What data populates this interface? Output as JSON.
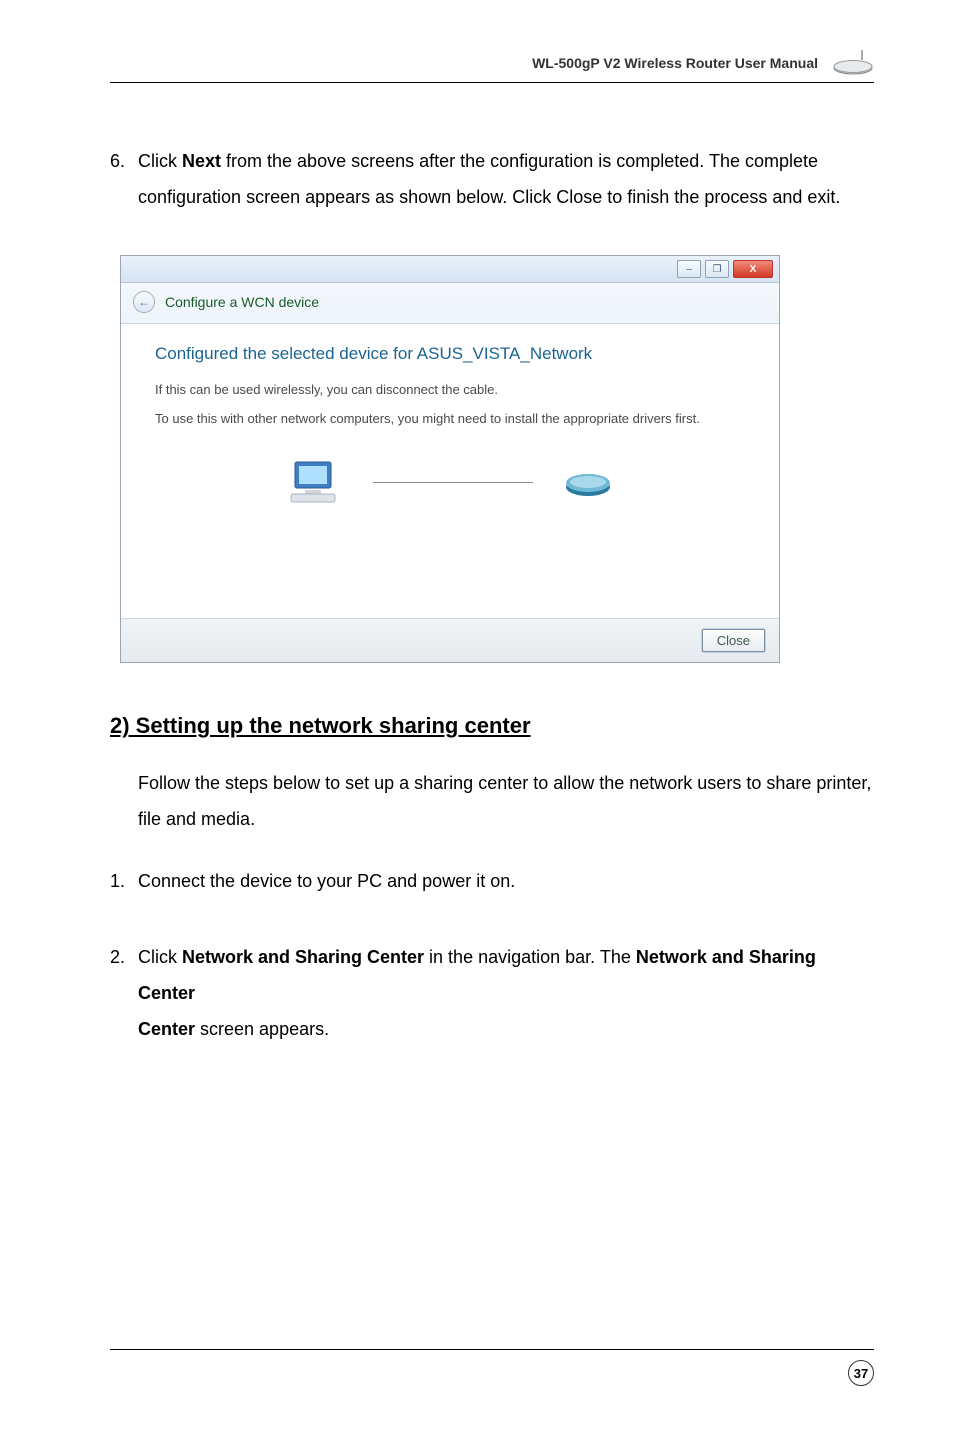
{
  "header": {
    "title": "WL-500gP V2 Wireless Router User Manual"
  },
  "step6": {
    "num": "6.",
    "line1_a": "Click ",
    "line1_b": "Next",
    "line1_c": " from the above screens after the configuration is completed. The complete",
    "line2_a": "configuration screen appears as shown below. Click ",
    "line2_b": "Close",
    "line2_c": " to finish the process and exit."
  },
  "screenshot": {
    "window_label": "Configure a WCN device",
    "heading": "Configured the selected device for ASUS_VISTA_Network",
    "p1": "If this  can be used wirelessly, you can disconnect the cable.",
    "p2": "To use this  with other network computers, you might need to install the appropriate drivers first.",
    "close_label": "Close",
    "min_glyph": "–",
    "max_glyph": "❐",
    "close_glyph": "X",
    "back_glyph": "←"
  },
  "section": {
    "heading": "2) Setting up the network sharing center",
    "intro": "Follow the steps below to set up a sharing center to allow the network users to share printer, file and media."
  },
  "step1": {
    "num": "1.",
    "text": "Connect the device to your PC and power it on."
  },
  "step2": {
    "num": "2.",
    "a": "Click ",
    "b": "Network and Sharing Center",
    "c": " in the navigation bar. The ",
    "d": "Network and Sharing Center",
    "e": " screen appears."
  },
  "page_number": "37"
}
